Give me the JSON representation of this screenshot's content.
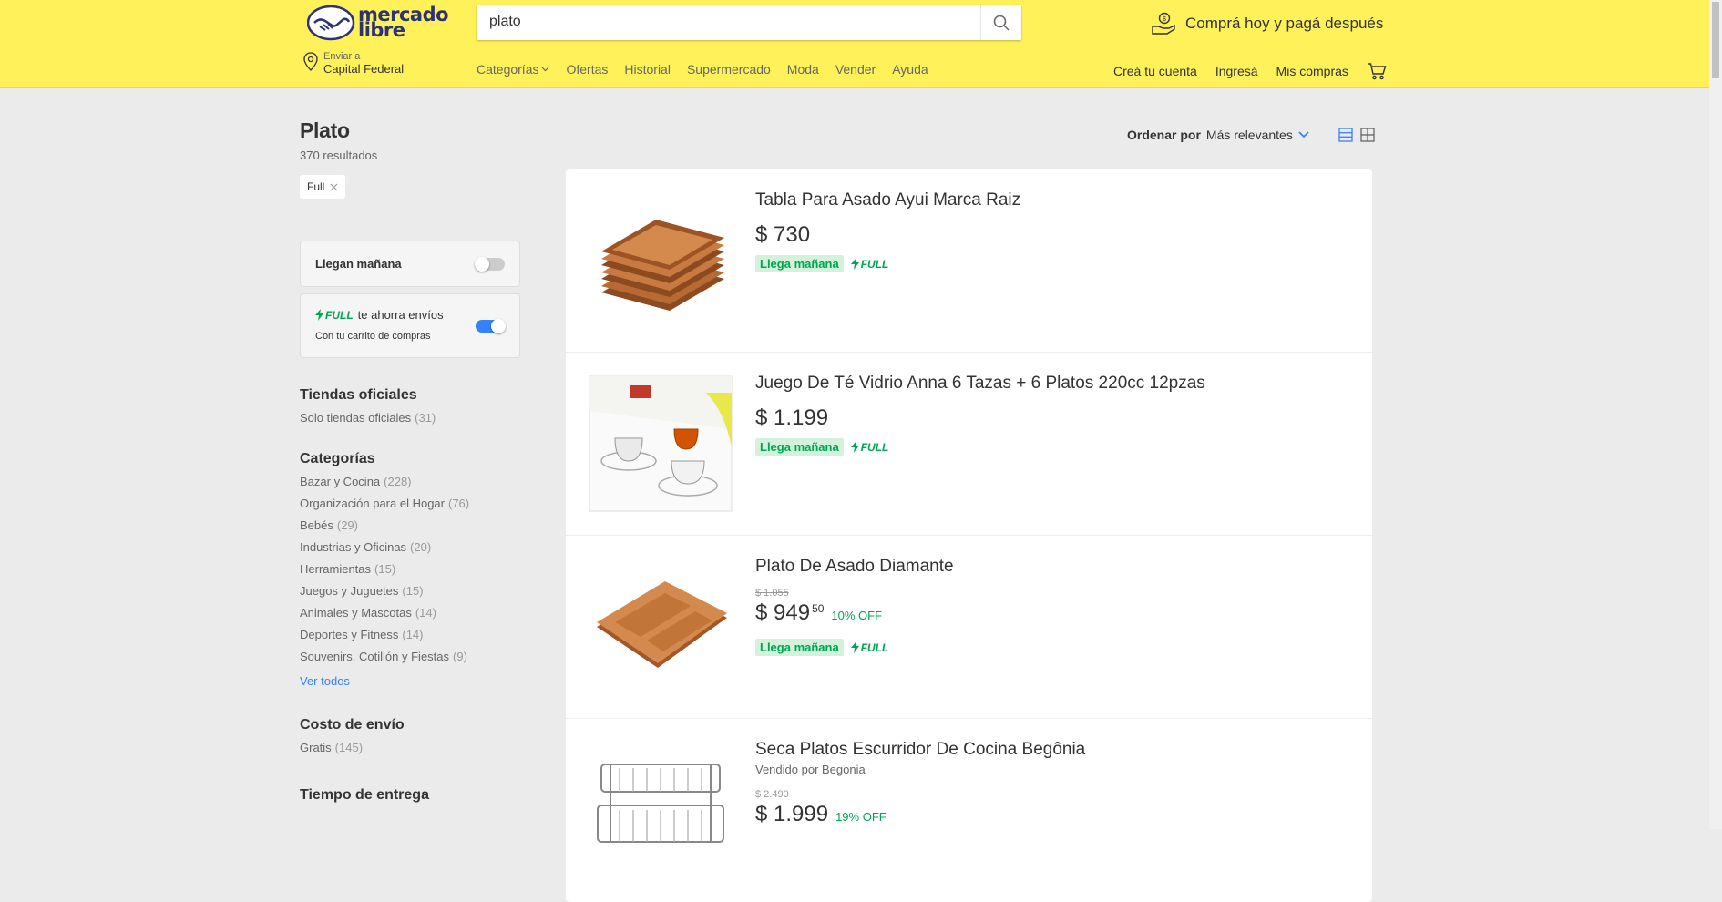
{
  "header": {
    "logo_line1": "mercado",
    "logo_line2": "libre",
    "search_value": "plato",
    "promo": "Comprá hoy y pagá después",
    "location_label": "Enviar a",
    "location_value": "Capital Federal",
    "nav": [
      "Categorías",
      "Ofertas",
      "Historial",
      "Supermercado",
      "Moda",
      "Vender",
      "Ayuda"
    ],
    "user_nav": [
      "Creá tu cuenta",
      "Ingresá",
      "Mis compras"
    ]
  },
  "sidebar": {
    "title": "Plato",
    "results": "370 resultados",
    "chip": "Full",
    "toggle1_label": "Llegan mañana",
    "toggle1_on": false,
    "toggle2_brand": "FULL",
    "toggle2_label": "te ahorra envíos",
    "toggle2_sub": "Con tu carrito de compras",
    "toggle2_on": true,
    "sections": [
      {
        "title": "Tiendas oficiales",
        "items": [
          {
            "label": "Solo tiendas oficiales",
            "count": "(31)"
          }
        ]
      },
      {
        "title": "Categorías",
        "items": [
          {
            "label": "Bazar y Cocina",
            "count": "(228)"
          },
          {
            "label": "Organización para el Hogar",
            "count": "(76)"
          },
          {
            "label": "Bebés",
            "count": "(29)"
          },
          {
            "label": "Industrias y Oficinas",
            "count": "(20)"
          },
          {
            "label": "Herramientas",
            "count": "(15)"
          },
          {
            "label": "Juegos y Juguetes",
            "count": "(15)"
          },
          {
            "label": "Animales y Mascotas",
            "count": "(14)"
          },
          {
            "label": "Deportes y Fitness",
            "count": "(14)"
          },
          {
            "label": "Souvenirs, Cotillón y Fiestas",
            "count": "(9)"
          }
        ],
        "see_all": "Ver todos"
      },
      {
        "title": "Costo de envío",
        "items": [
          {
            "label": "Gratis",
            "count": "(145)"
          }
        ]
      },
      {
        "title": "Tiempo de entrega",
        "items": []
      }
    ]
  },
  "sort": {
    "label": "Ordenar por",
    "value": "Más relevantes"
  },
  "items": [
    {
      "title": "Tabla Para Asado Ayui Marca Raiz",
      "seller": "",
      "orig": "",
      "price": "$ 730",
      "cents": "",
      "off": "",
      "llega": "Llega mañana",
      "full": "FULL",
      "img": "board-stack"
    },
    {
      "title": "Juego De Té Vidrio Anna 6 Tazas + 6 Platos 220cc 12pzas",
      "seller": "",
      "orig": "",
      "price": "$ 1.199",
      "cents": "",
      "off": "",
      "llega": "Llega mañana",
      "full": "FULL",
      "img": "tea-set"
    },
    {
      "title": "Plato De Asado Diamante",
      "seller": "",
      "orig": "$ 1.055",
      "price": "$ 949",
      "cents": "50",
      "off": "10% OFF",
      "llega": "Llega mañana",
      "full": "FULL",
      "img": "board"
    },
    {
      "title": "Seca Platos Escurridor De Cocina Begônia",
      "seller": "Vendido por Begonia",
      "orig": "$ 2.490",
      "price": "$ 1.999",
      "cents": "",
      "off": "19% OFF",
      "llega": "",
      "full": "",
      "img": "rack"
    }
  ],
  "colors": {
    "header": "#fff159",
    "accent": "#3483fa",
    "green": "#00a650"
  }
}
